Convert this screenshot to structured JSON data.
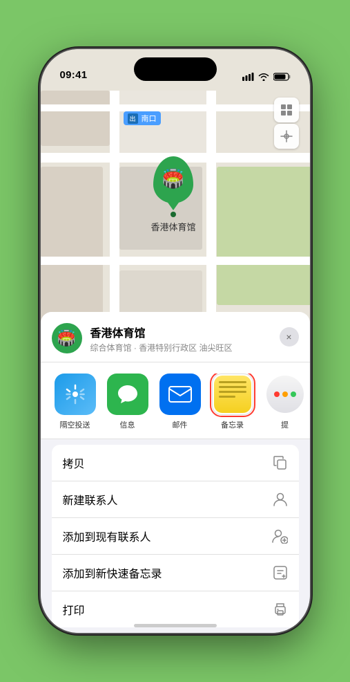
{
  "phone": {
    "status_bar": {
      "time": "09:41",
      "signal_icon": "signal",
      "wifi_icon": "wifi",
      "battery_icon": "battery"
    }
  },
  "map": {
    "label_text": "南口",
    "marker_label": "香港体育馆",
    "controls": {
      "map_type_icon": "map-layers",
      "location_icon": "location-arrow"
    }
  },
  "bottom_sheet": {
    "header": {
      "title": "香港体育馆",
      "subtitle": "综合体育馆 · 香港特别行政区 油尖旺区",
      "close_label": "×"
    },
    "apps": [
      {
        "id": "airdrop",
        "label": "隔空投送",
        "icon": "airdrop"
      },
      {
        "id": "messages",
        "label": "信息",
        "icon": "messages"
      },
      {
        "id": "mail",
        "label": "邮件",
        "icon": "mail"
      },
      {
        "id": "notes",
        "label": "备忘录",
        "icon": "notes",
        "selected": true
      },
      {
        "id": "more",
        "label": "提",
        "icon": "more"
      }
    ],
    "actions": [
      {
        "id": "copy",
        "label": "拷贝",
        "icon": "copy"
      },
      {
        "id": "add-contact",
        "label": "新建联系人",
        "icon": "person-add"
      },
      {
        "id": "add-existing",
        "label": "添加到现有联系人",
        "icon": "person-badge-plus"
      },
      {
        "id": "add-note",
        "label": "添加到新快速备忘录",
        "icon": "note-add"
      },
      {
        "id": "print",
        "label": "打印",
        "icon": "print"
      }
    ]
  }
}
